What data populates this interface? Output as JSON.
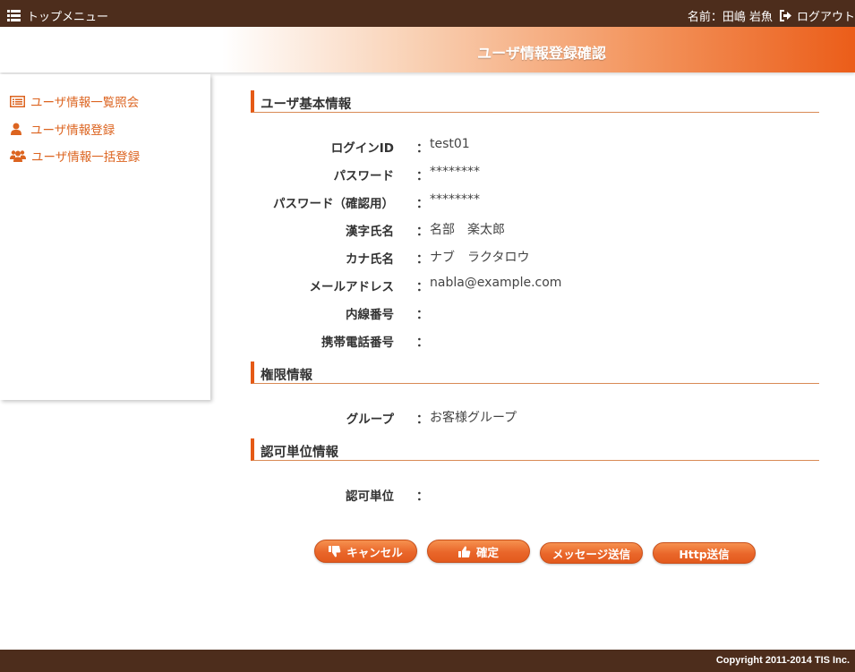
{
  "topbar": {
    "menu_label": "トップメニュー",
    "user_name": "名前：田嶋 岩魚",
    "logout_label": "ログアウト"
  },
  "title": "ユーザ情報登録確認",
  "sidebar": {
    "items": [
      {
        "label": "ユーザ情報一覧照会",
        "icon": "list-icon"
      },
      {
        "label": "ユーザ情報登録",
        "icon": "user-icon"
      },
      {
        "label": "ユーザ情報一括登録",
        "icon": "users-icon"
      }
    ]
  },
  "sections": {
    "basic": {
      "title": "ユーザ基本情報",
      "rows": [
        {
          "label": "ログインID",
          "value": "test01"
        },
        {
          "label": "パスワード",
          "value": "********"
        },
        {
          "label": "パスワード（確認用）",
          "value": "********"
        },
        {
          "label": "漢字氏名",
          "value": "名部　楽太郎"
        },
        {
          "label": "カナ氏名",
          "value": "ナブ　ラクタロウ"
        },
        {
          "label": "メールアドレス",
          "value": "nabla@example.com"
        },
        {
          "label": "内線番号",
          "value": ""
        },
        {
          "label": "携帯電話番号",
          "value": ""
        }
      ]
    },
    "permission": {
      "title": "権限情報",
      "rows": [
        {
          "label": "グループ",
          "value": "お客様グループ"
        }
      ]
    },
    "auth_unit": {
      "title": "認可単位情報",
      "rows": [
        {
          "label": "認可単位",
          "value": ""
        }
      ]
    }
  },
  "colon": "：",
  "buttons": {
    "cancel": "キャンセル",
    "confirm": "確定",
    "message_send": "メッセージ送信",
    "http_send": "Http送信"
  },
  "footer": {
    "copyright": "Copyright 2011-2014 TIS Inc."
  },
  "colors": {
    "bar": "#4d2d1c",
    "accent": "#e55a16",
    "link": "#dc6420"
  }
}
